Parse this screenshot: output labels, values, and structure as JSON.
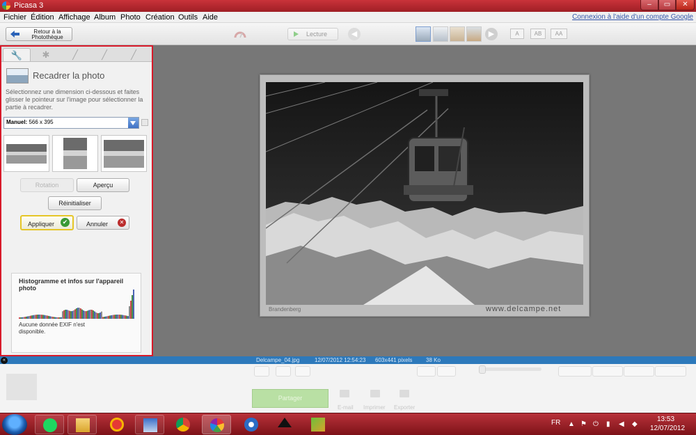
{
  "window": {
    "title": "Picasa 3",
    "minimize_glyph": "–",
    "maximize_glyph": "▭",
    "close_glyph": "✕"
  },
  "menu": {
    "items": [
      "Fichier",
      "Édition",
      "Affichage",
      "Album",
      "Photo",
      "Création",
      "Outils",
      "Aide"
    ],
    "signin": "Connexion à l'aide d'un compte Google"
  },
  "toolbar": {
    "back_label": "Retour à la Photothèque",
    "play_label": "Lecture",
    "font_buttons": [
      "A",
      "AB",
      "AA"
    ]
  },
  "panel": {
    "tab_icons": [
      "wrench-icon",
      "sun-icon",
      "brush-icon",
      "brush-two-icon",
      "brush-three-icon"
    ],
    "tab_glyphs": [
      "🔧",
      "✱",
      "╱",
      "╱",
      "╱"
    ],
    "title": "Recadrer la photo",
    "description": "Sélectionnez une dimension ci-dessous et faites glisser le pointeur sur l'image pour sélectionner la partie à recadrer.",
    "select_label": "Manuel:",
    "select_value": "566 x 395",
    "rotation_label": "Rotation",
    "preview_label": "Aperçu",
    "reset_label": "Réinitialiser",
    "apply_label": "Appliquer",
    "cancel_label": "Annuler",
    "histogram_title": "Histogramme et infos sur l'appareil photo",
    "exif_note": "Aucune donnée EXIF n'est disponible."
  },
  "photo": {
    "caption_left": "Brandenberg",
    "caption_right": "www.delcampe.net"
  },
  "info": {
    "collapse_glyph": "«",
    "filename": "Delcampe_04.jpg",
    "datetime": "12/07/2012 12:54:23",
    "dimensions": "603x441 pixels",
    "size": "38 Ko"
  },
  "tray": {
    "share_label": "Partager",
    "email_label": "E-mail",
    "print_label": "Imprimer",
    "export_label": "Exporter"
  },
  "taskbar": {
    "apps": [
      "windows-explorer",
      "spotify",
      "file-explorer",
      "headphones-app",
      "screen-capture",
      "chrome",
      "picasa",
      "thunderbird",
      "inkscape",
      "media-app"
    ],
    "language": "FR",
    "time": "13:53",
    "date": "12/07/2012"
  },
  "colors": {
    "accent": "#d81a2a",
    "title_bar": "#b52a31",
    "info_strip": "#2d79bb",
    "share_green": "#b9e0a4"
  }
}
